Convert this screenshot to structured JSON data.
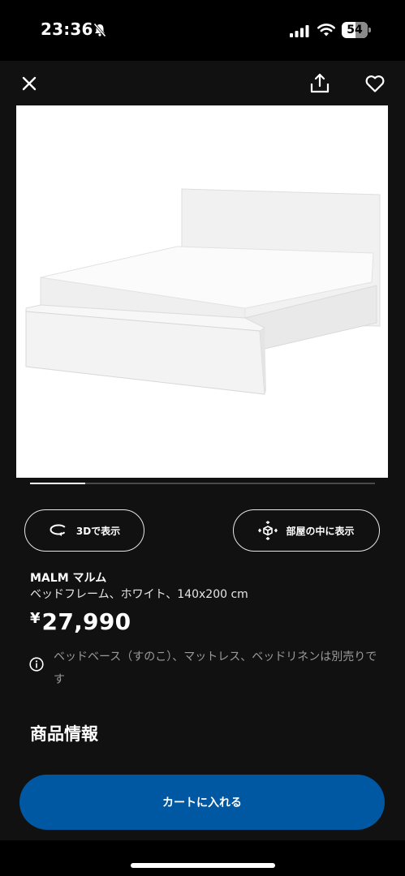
{
  "status_bar": {
    "time": "23:36",
    "battery_level": "54",
    "battery_fraction": 0.54
  },
  "top_bar": {
    "icons": [
      "close-icon",
      "share-icon",
      "heart-icon"
    ]
  },
  "gallery": {
    "image_subject": "white bed frame",
    "progress_fraction": 0.16
  },
  "actions": {
    "view_3d_label": "3Dで表示",
    "view_in_room_label": "部屋の中に表示"
  },
  "product": {
    "name": "MALM マルム",
    "description": "ベッドフレーム、ホワイト、140x200 cm",
    "price_currency": "¥",
    "price_amount": "27,990",
    "note": "ベッドベース（すのこ）、マットレス、ベッドリネンは別売りです"
  },
  "sections": {
    "product_info_title": "商品情報"
  },
  "cart": {
    "add_to_cart_label": "カートに入れる"
  },
  "colors": {
    "accent": "#0058a3",
    "background": "#111111"
  }
}
